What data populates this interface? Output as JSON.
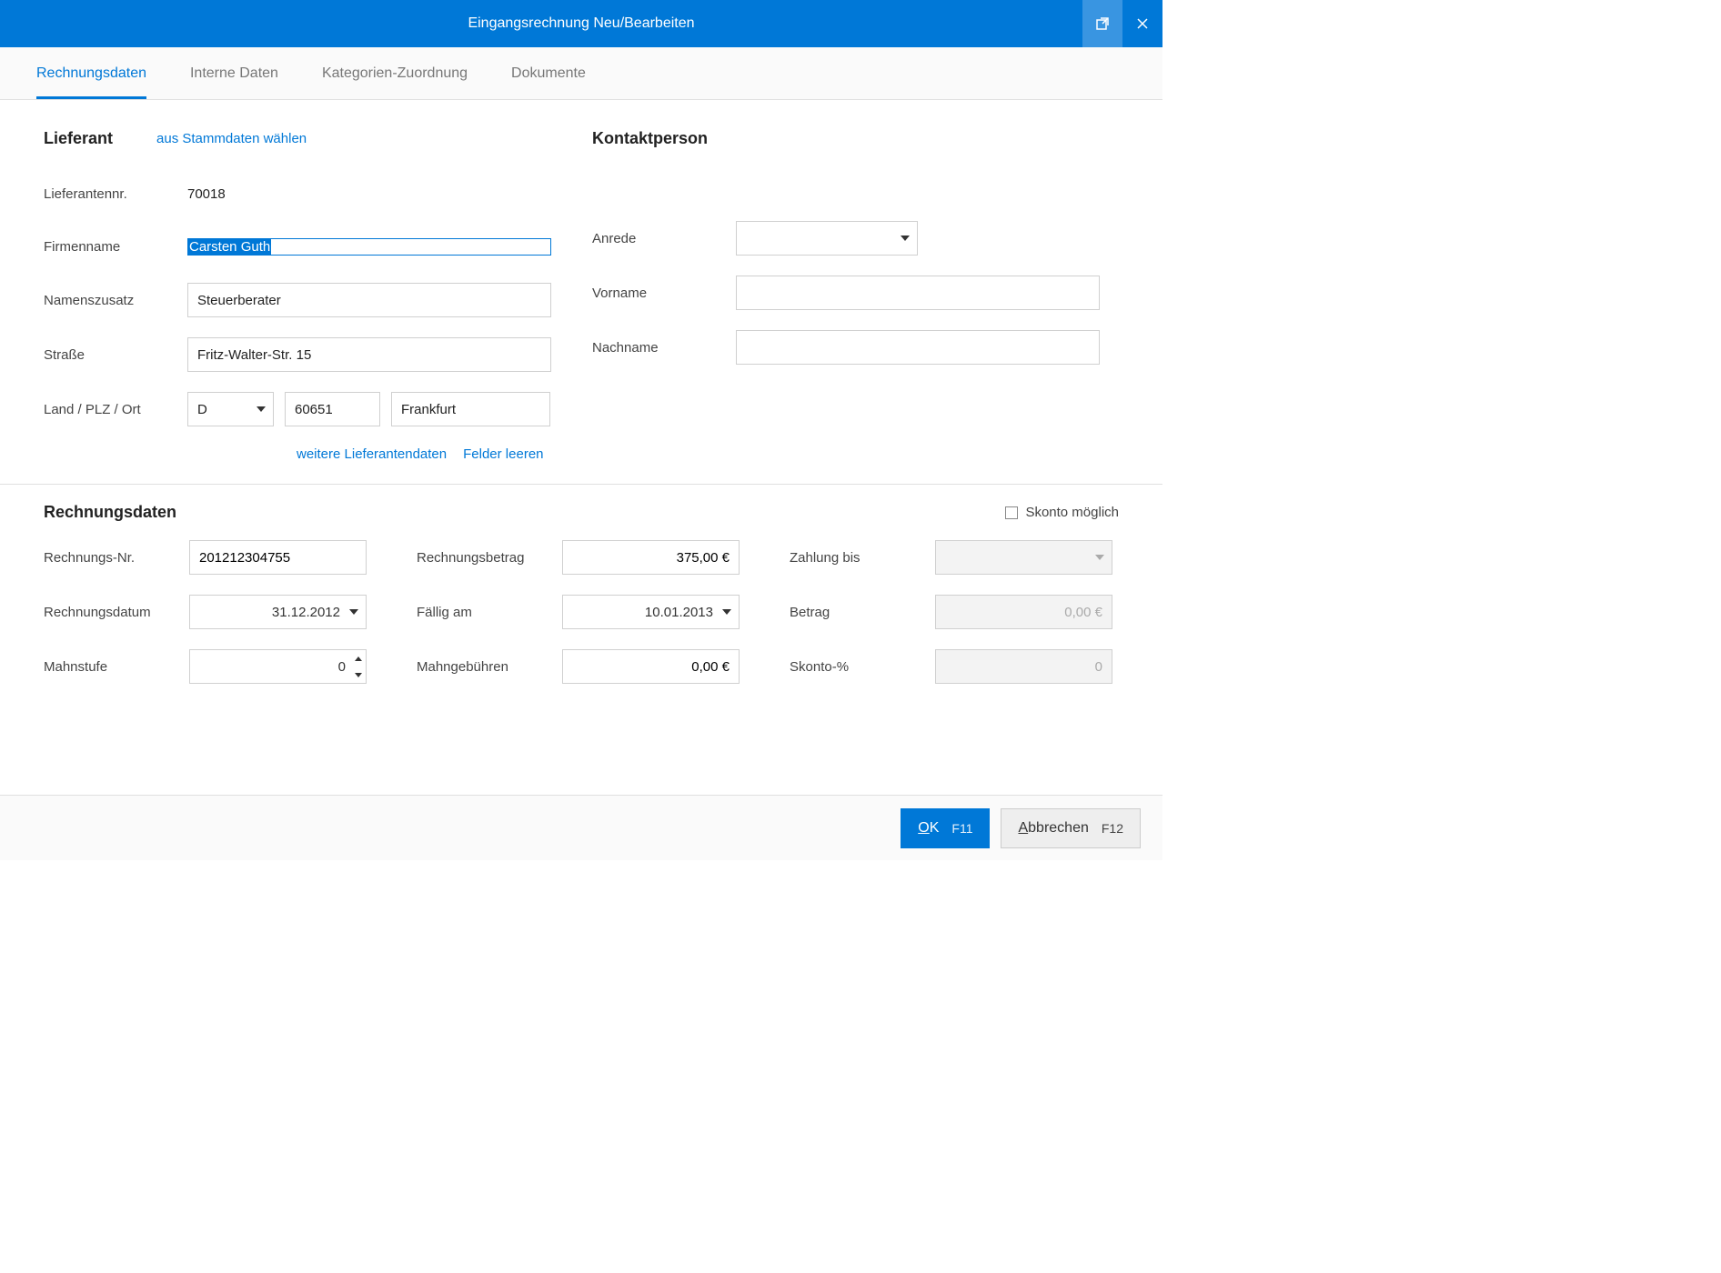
{
  "window": {
    "title": "Eingangsrechnung Neu/Bearbeiten"
  },
  "tabs": {
    "rechnungsdaten": "Rechnungsdaten",
    "interne": "Interne Daten",
    "kategorien": "Kategorien-Zuordnung",
    "dokumente": "Dokumente"
  },
  "lieferant": {
    "heading": "Lieferant",
    "stammdaten_link": "aus Stammdaten wählen",
    "nr_label": "Lieferantennr.",
    "nr_value": "70018",
    "firmenname_label": "Firmenname",
    "firmenname_value": "Carsten Guth",
    "zusatz_label": "Namenszusatz",
    "zusatz_value": "Steuerberater",
    "strasse_label": "Straße",
    "strasse_value": "Fritz-Walter-Str. 15",
    "lpo_label": "Land / PLZ / Ort",
    "land_value": "D",
    "plz_value": "60651",
    "ort_value": "Frankfurt",
    "weitere_link": "weitere Lieferantendaten",
    "leeren_link": "Felder leeren"
  },
  "kontakt": {
    "heading": "Kontaktperson",
    "anrede_label": "Anrede",
    "anrede_value": "",
    "vorname_label": "Vorname",
    "vorname_value": "",
    "nachname_label": "Nachname",
    "nachname_value": ""
  },
  "rechnung": {
    "heading": "Rechnungsdaten",
    "skonto_label": "Skonto möglich",
    "nr_label": "Rechnungs-Nr.",
    "nr_value": "201212304755",
    "betrag_label": "Rechnungsbetrag",
    "betrag_value": "375,00 €",
    "zahlung_bis_label": "Zahlung bis",
    "zahlung_bis_value": "",
    "datum_label": "Rechnungsdatum",
    "datum_value": "31.12.2012",
    "faellig_label": "Fällig am",
    "faellig_value": "10.01.2013",
    "skonto_betrag_label": "Betrag",
    "skonto_betrag_value": "0,00 €",
    "mahnstufe_label": "Mahnstufe",
    "mahnstufe_value": "0",
    "mahngeb_label": "Mahngebühren",
    "mahngeb_value": "0,00 €",
    "skonto_pct_label": "Skonto-%",
    "skonto_pct_value": "0"
  },
  "footer": {
    "ok_label": "K",
    "ok_prefix": "O",
    "ok_fkey": "F11",
    "cancel_prefix": "A",
    "cancel_label": "bbrechen",
    "cancel_fkey": "F12"
  }
}
